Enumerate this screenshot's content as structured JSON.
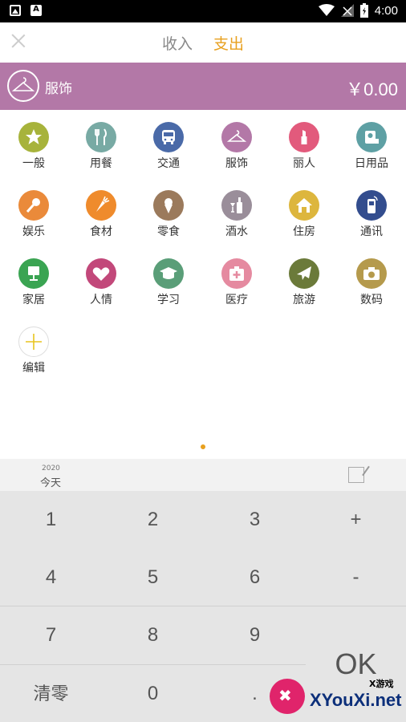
{
  "status_bar": {
    "time": "4:00"
  },
  "header": {
    "tabs": [
      "收入",
      "支出"
    ],
    "active_tab": "支出"
  },
  "selected_category": {
    "name": "服饰",
    "amount": "￥0.00",
    "color": "#b378a7"
  },
  "categories": [
    {
      "label": "一般",
      "icon": "star-icon",
      "color": "#a7b33b"
    },
    {
      "label": "用餐",
      "icon": "utensils-icon",
      "color": "#78aaa4"
    },
    {
      "label": "交通",
      "icon": "bus-icon",
      "color": "#4a6aa8"
    },
    {
      "label": "服饰",
      "icon": "hanger-icon",
      "color": "#b378a7"
    },
    {
      "label": "丽人",
      "icon": "lipstick-icon",
      "color": "#e25a7c"
    },
    {
      "label": "日用品",
      "icon": "toilet-paper-icon",
      "color": "#5ea0a4"
    },
    {
      "label": "娱乐",
      "icon": "microphone-icon",
      "color": "#ea8a3a"
    },
    {
      "label": "食材",
      "icon": "carrot-icon",
      "color": "#ef8b2c"
    },
    {
      "label": "零食",
      "icon": "ice-cream-icon",
      "color": "#9b7a5c"
    },
    {
      "label": "酒水",
      "icon": "bottle-icon",
      "color": "#9a8e9a"
    },
    {
      "label": "住房",
      "icon": "house-icon",
      "color": "#ddb63d"
    },
    {
      "label": "通讯",
      "icon": "phone-icon",
      "color": "#334d8e"
    },
    {
      "label": "家居",
      "icon": "lamp-icon",
      "color": "#3aa452"
    },
    {
      "label": "人情",
      "icon": "heart-icon",
      "color": "#c2487a"
    },
    {
      "label": "学习",
      "icon": "graduation-cap-icon",
      "color": "#5a9e78"
    },
    {
      "label": "医疗",
      "icon": "medical-kit-icon",
      "color": "#e58aa0"
    },
    {
      "label": "旅游",
      "icon": "airplane-icon",
      "color": "#6b7a3a"
    },
    {
      "label": "数码",
      "icon": "camera-icon",
      "color": "#b59a4c"
    }
  ],
  "edit": {
    "label": "编辑",
    "icon": "plus-icon",
    "color": "#e8c41e"
  },
  "date": {
    "year": "2020",
    "day": "今天"
  },
  "keypad": {
    "keys": [
      "1",
      "2",
      "3",
      "+",
      "4",
      "5",
      "6",
      "-",
      "7",
      "8",
      "9",
      "清零",
      "0",
      "."
    ],
    "ok": "OK"
  },
  "watermark": {
    "small": "X游戏",
    "text": "XYouXi.net"
  }
}
